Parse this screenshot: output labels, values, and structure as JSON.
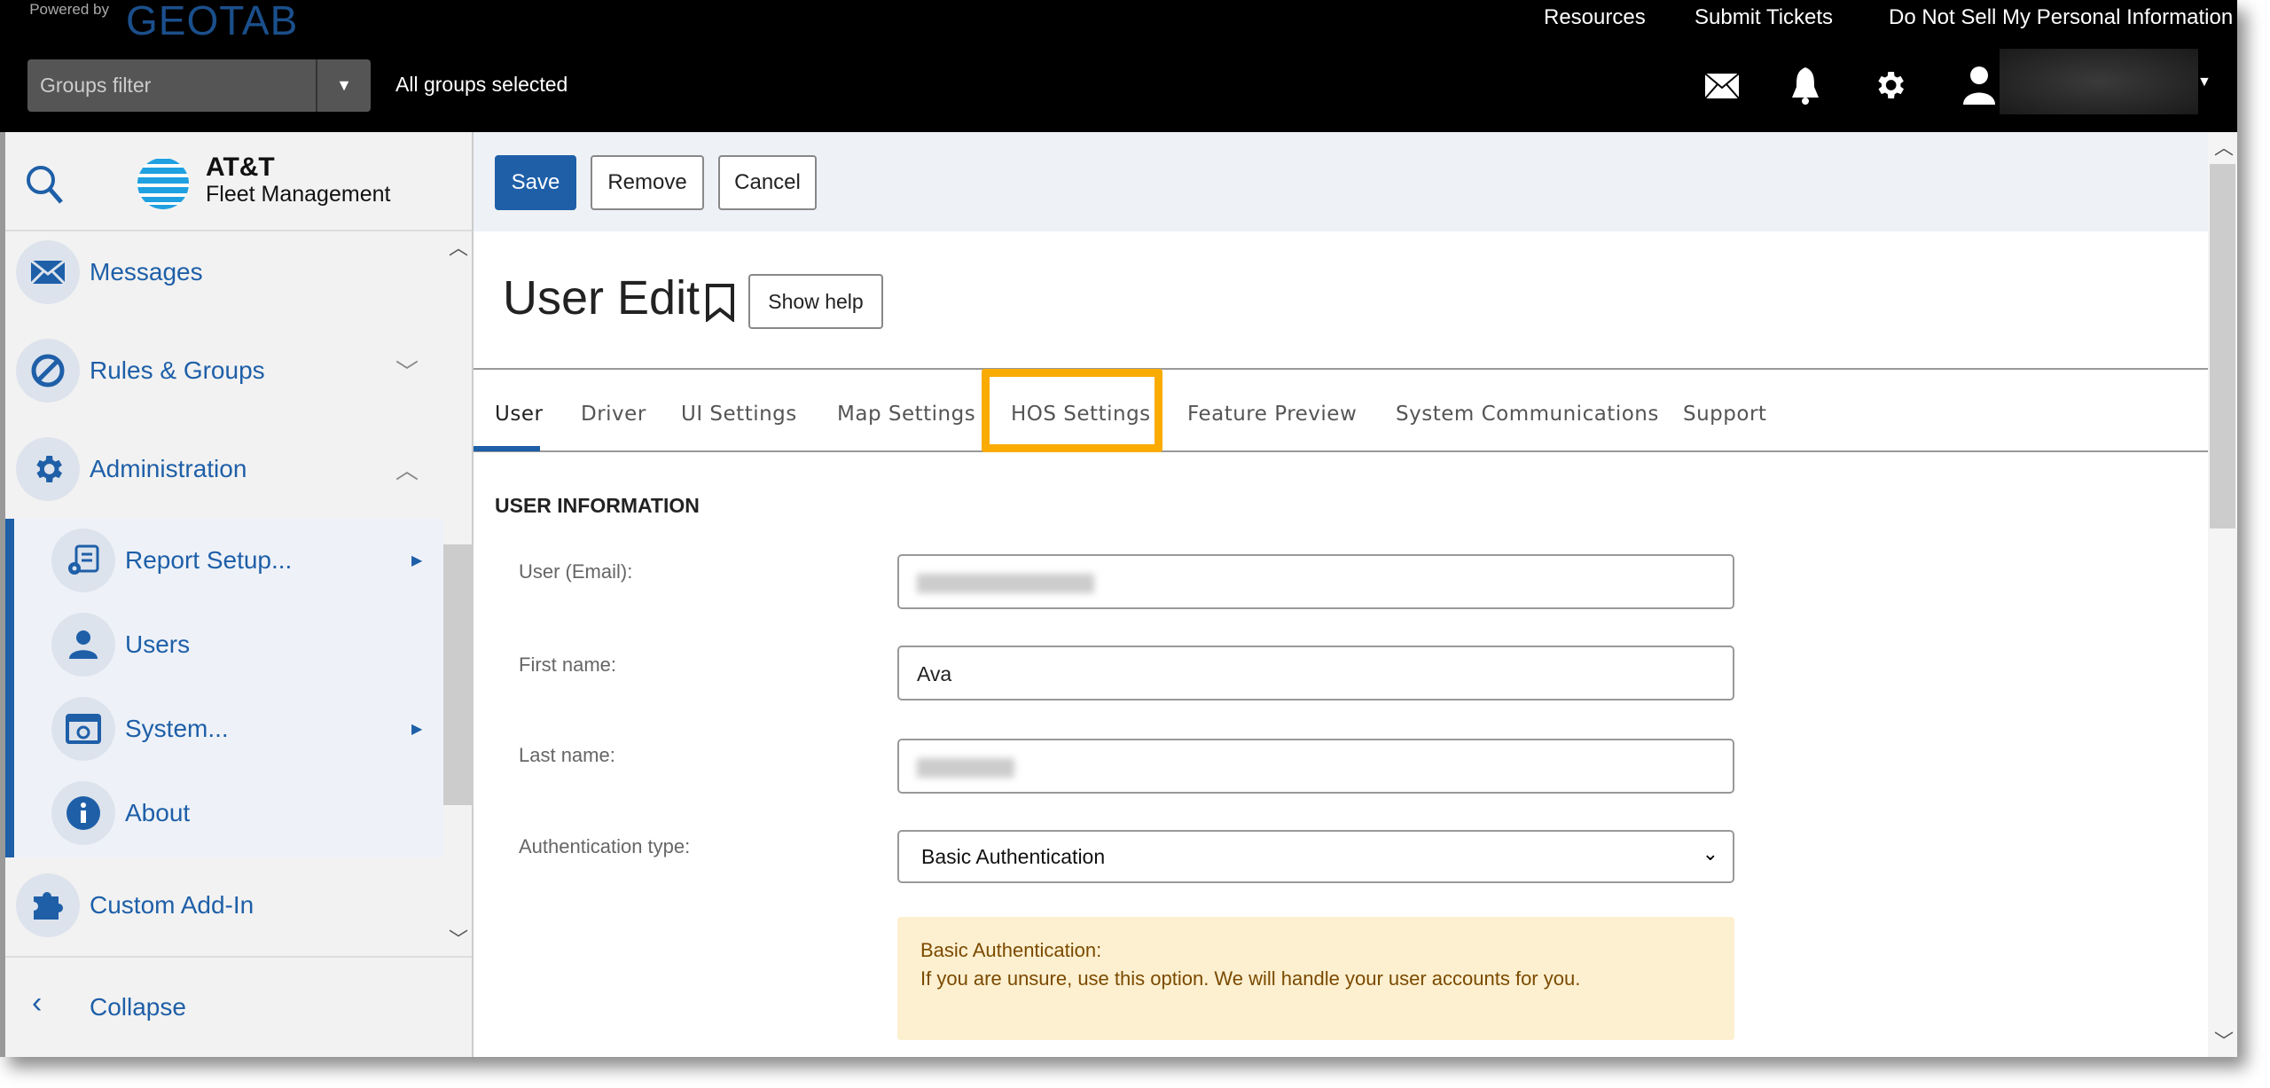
{
  "header": {
    "powered_by": "Powered by",
    "brand": "GEOTAB",
    "groups_filter_placeholder": "Groups filter",
    "groups_status": "All groups selected",
    "links": [
      "Resources",
      "Submit Tickets",
      "Do Not Sell My Personal Information"
    ],
    "icons": [
      "mail-icon",
      "bell-icon",
      "gear-icon",
      "user-icon"
    ]
  },
  "sidebar": {
    "logo_line1": "AT&T",
    "logo_line2": "Fleet Management",
    "items": [
      {
        "label": "Messages",
        "icon": "envelope-icon"
      },
      {
        "label": "Rules & Groups",
        "icon": "prohibit-icon"
      },
      {
        "label": "Administration",
        "icon": "gear-icon"
      },
      {
        "label": "Custom Add-In",
        "icon": "puzzle-icon"
      }
    ],
    "sub_items": [
      {
        "label": "Report Setup...",
        "icon": "report-setup-icon"
      },
      {
        "label": "Users",
        "icon": "user-icon"
      },
      {
        "label": "System...",
        "icon": "system-icon"
      },
      {
        "label": "About",
        "icon": "info-icon"
      }
    ],
    "collapse": "Collapse"
  },
  "toolbar": {
    "save": "Save",
    "remove": "Remove",
    "cancel": "Cancel"
  },
  "page": {
    "title": "User Edit",
    "show_help": "Show help"
  },
  "tabs": [
    "User",
    "Driver",
    "UI Settings",
    "Map Settings",
    "HOS Settings",
    "Feature Preview",
    "System Communications",
    "Support"
  ],
  "active_tab": "User",
  "highlighted_tab": "HOS Settings",
  "form": {
    "section": "USER INFORMATION",
    "email_label": "User (Email):",
    "first_label": "First name:",
    "first_value": "Ava",
    "last_label": "Last name:",
    "auth_label": "Authentication type:",
    "auth_value": "Basic Authentication",
    "info_title": "Basic Authentication:",
    "info_text": "If you are unsure, use this option. We will handle your user accounts for you."
  },
  "colors": {
    "accent": "#1e5fa8",
    "highlight": "#f9ab00",
    "info_bg": "#fdf0d0",
    "info_text": "#7a4a00"
  }
}
